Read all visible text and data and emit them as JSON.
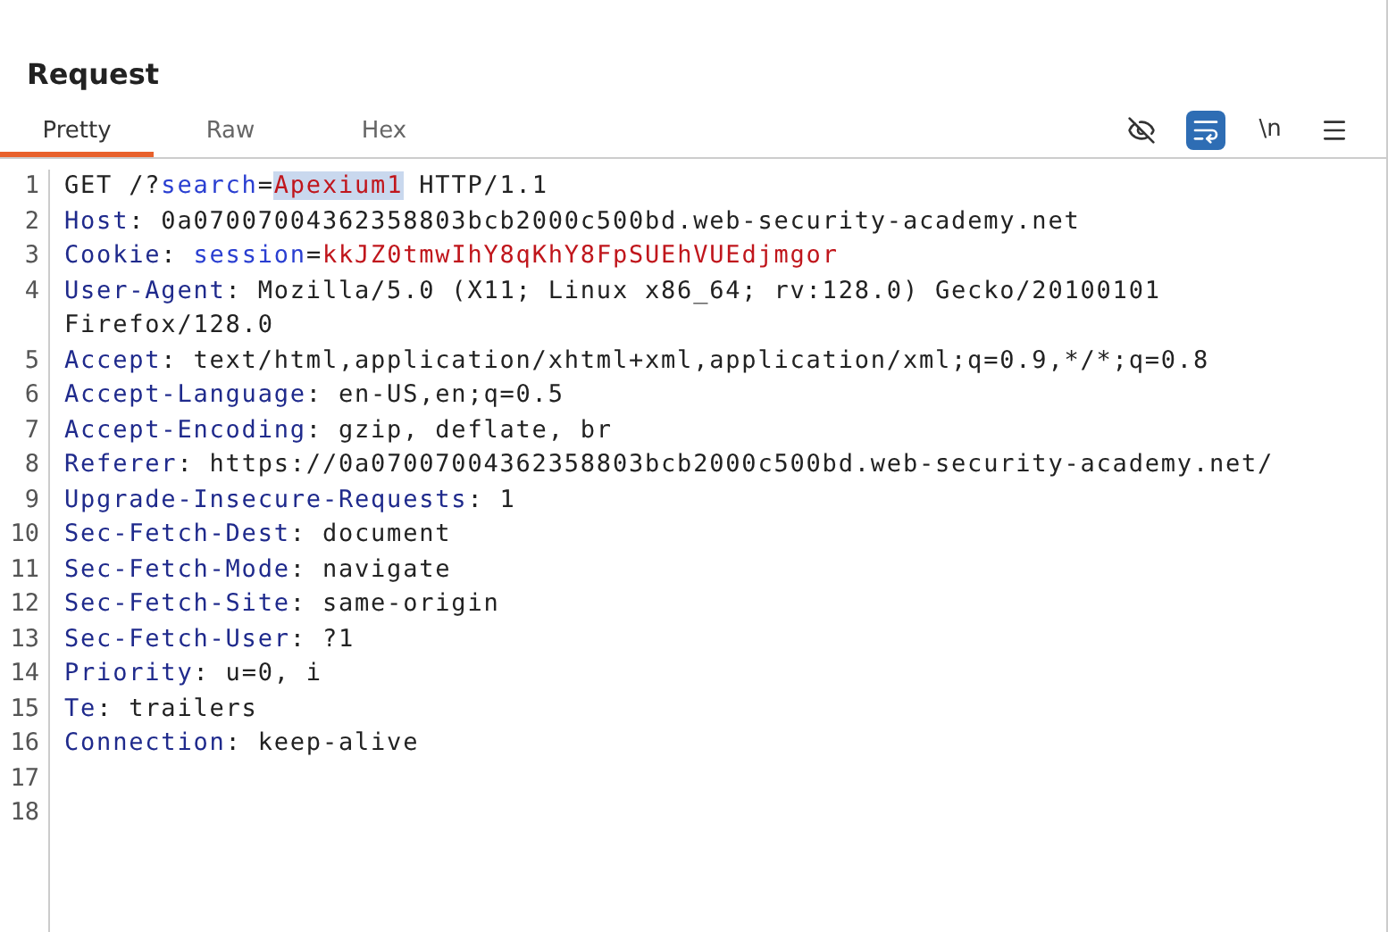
{
  "panel": {
    "title": "Request"
  },
  "tabs": [
    {
      "label": "Pretty",
      "selected": true
    },
    {
      "label": "Raw",
      "selected": false
    },
    {
      "label": "Hex",
      "selected": false
    }
  ],
  "toolbar": [
    {
      "kind": "hide",
      "on": false
    },
    {
      "kind": "wrap",
      "on": true
    },
    {
      "kind": "newline",
      "label": "\\n",
      "on": false
    },
    {
      "kind": "menu",
      "on": false
    }
  ],
  "lines": [
    {
      "number": "1",
      "segments": [
        {
          "kind": "plain",
          "text": "GET /?"
        },
        {
          "kind": "param",
          "text": "search"
        },
        {
          "kind": "plain",
          "text": "="
        },
        {
          "kind": "highlight",
          "text": "Apexium1"
        },
        {
          "kind": "plain",
          "text": " HTTP/1.1"
        }
      ]
    },
    {
      "number": "2",
      "segments": [
        {
          "kind": "key",
          "text": "Host"
        },
        {
          "kind": "plain",
          "text": ": 0a07007004362358803bcb2000c500bd.web-security-academy.net"
        }
      ]
    },
    {
      "number": "3",
      "segments": [
        {
          "kind": "key",
          "text": "Cookie"
        },
        {
          "kind": "plain",
          "text": ": "
        },
        {
          "kind": "param",
          "text": "session"
        },
        {
          "kind": "plain",
          "text": "="
        },
        {
          "kind": "value",
          "text": "kkJZ0tmwIhY8qKhY8FpSUEhVUEdjmgor"
        }
      ]
    },
    {
      "number": "4",
      "segments": [
        {
          "kind": "key",
          "text": "User-Agent"
        },
        {
          "kind": "plain",
          "text": ": Mozilla/5.0 (X11; Linux x86_64; rv:128.0) Gecko/20100101 Firefox/128.0"
        }
      ]
    },
    {
      "number": "5",
      "segments": [
        {
          "kind": "key",
          "text": "Accept"
        },
        {
          "kind": "plain",
          "text": ": text/html,application/xhtml+xml,application/xml;q=0.9,*/*;q=0.8"
        }
      ]
    },
    {
      "number": "6",
      "segments": [
        {
          "kind": "key",
          "text": "Accept-Language"
        },
        {
          "kind": "plain",
          "text": ": en-US,en;q=0.5"
        }
      ]
    },
    {
      "number": "7",
      "segments": [
        {
          "kind": "key",
          "text": "Accept-Encoding"
        },
        {
          "kind": "plain",
          "text": ": gzip, deflate, br"
        }
      ]
    },
    {
      "number": "8",
      "segments": [
        {
          "kind": "key",
          "text": "Referer"
        },
        {
          "kind": "plain",
          "text": ": https://0a07007004362358803bcb2000c500bd.web-security-academy.net/"
        }
      ]
    },
    {
      "number": "9",
      "segments": [
        {
          "kind": "key",
          "text": "Upgrade-Insecure-Requests"
        },
        {
          "kind": "plain",
          "text": ": 1"
        }
      ]
    },
    {
      "number": "10",
      "segments": [
        {
          "kind": "key",
          "text": "Sec-Fetch-Dest"
        },
        {
          "kind": "plain",
          "text": ": document"
        }
      ]
    },
    {
      "number": "11",
      "segments": [
        {
          "kind": "key",
          "text": "Sec-Fetch-Mode"
        },
        {
          "kind": "plain",
          "text": ": navigate"
        }
      ]
    },
    {
      "number": "12",
      "segments": [
        {
          "kind": "key",
          "text": "Sec-Fetch-Site"
        },
        {
          "kind": "plain",
          "text": ": same-origin"
        }
      ]
    },
    {
      "number": "13",
      "segments": [
        {
          "kind": "key",
          "text": "Sec-Fetch-User"
        },
        {
          "kind": "plain",
          "text": ": ?1"
        }
      ]
    },
    {
      "number": "14",
      "segments": [
        {
          "kind": "key",
          "text": "Priority"
        },
        {
          "kind": "plain",
          "text": ": u=0, i"
        }
      ]
    },
    {
      "number": "15",
      "segments": [
        {
          "kind": "key",
          "text": "Te"
        },
        {
          "kind": "plain",
          "text": ": trailers"
        }
      ]
    },
    {
      "number": "16",
      "segments": [
        {
          "kind": "key",
          "text": "Connection"
        },
        {
          "kind": "plain",
          "text": ": keep-alive"
        }
      ]
    },
    {
      "number": "17"
    },
    {
      "number": "18"
    }
  ]
}
